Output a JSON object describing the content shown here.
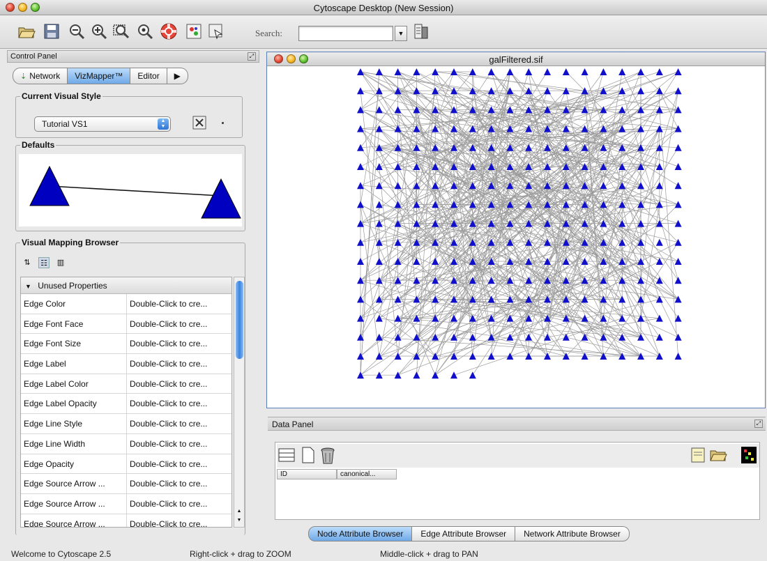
{
  "window": {
    "title": "Cytoscape Desktop (New Session)"
  },
  "toolbar": {
    "search_label": "Search:",
    "search_value": "",
    "icons": [
      "open-folder-icon",
      "save-icon",
      "zoom-out-icon",
      "zoom-in-icon",
      "zoom-fit-icon",
      "zoom-selected-icon",
      "help-icon",
      "vizmapper-icon",
      "layout-icon",
      "attribute-browser-icon"
    ]
  },
  "control_panel": {
    "title": "Control Panel",
    "tabs": [
      {
        "label": "Network",
        "active": false
      },
      {
        "label": "VizMapper™",
        "active": true
      },
      {
        "label": "Editor",
        "active": false
      }
    ],
    "current_visual_style": {
      "label": "Current Visual Style",
      "selected": "Tutorial VS1"
    },
    "defaults": {
      "label": "Defaults"
    },
    "visual_mapping_browser": {
      "label": "Visual Mapping Browser",
      "section": "Unused Properties",
      "rows": [
        {
          "name": "Edge Color",
          "value": "Double-Click to cre..."
        },
        {
          "name": "Edge Font Face",
          "value": "Double-Click to cre..."
        },
        {
          "name": "Edge Font Size",
          "value": "Double-Click to cre..."
        },
        {
          "name": "Edge Label",
          "value": "Double-Click to cre..."
        },
        {
          "name": "Edge Label Color",
          "value": "Double-Click to cre..."
        },
        {
          "name": "Edge Label Opacity",
          "value": "Double-Click to cre..."
        },
        {
          "name": "Edge Line Style",
          "value": "Double-Click to cre..."
        },
        {
          "name": "Edge Line Width",
          "value": "Double-Click to cre..."
        },
        {
          "name": "Edge Opacity",
          "value": "Double-Click to cre..."
        },
        {
          "name": "Edge Source Arrow ...",
          "value": "Double-Click to cre..."
        },
        {
          "name": "Edge Source Arrow ...",
          "value": "Double-Click to cre..."
        },
        {
          "name": "Edge Source Arrow ...",
          "value": "Double-Click to cre..."
        }
      ]
    }
  },
  "network_view": {
    "title": "galFiltered.sif",
    "node_color": "#1010cc",
    "grid_rows": 17,
    "grid_cols": 18,
    "last_row_count": 7
  },
  "data_panel": {
    "title": "Data Panel",
    "columns": [
      "ID",
      "canonical..."
    ],
    "tabs": [
      {
        "label": "Node Attribute Browser",
        "active": true
      },
      {
        "label": "Edge Attribute Browser",
        "active": false
      },
      {
        "label": "Network Attribute Browser",
        "active": false
      }
    ]
  },
  "statusbar": {
    "welcome": "Welcome to Cytoscape 2.5",
    "zoom_hint": "Right-click + drag  to  ZOOM",
    "pan_hint": "Middle-click + drag  to  PAN"
  }
}
